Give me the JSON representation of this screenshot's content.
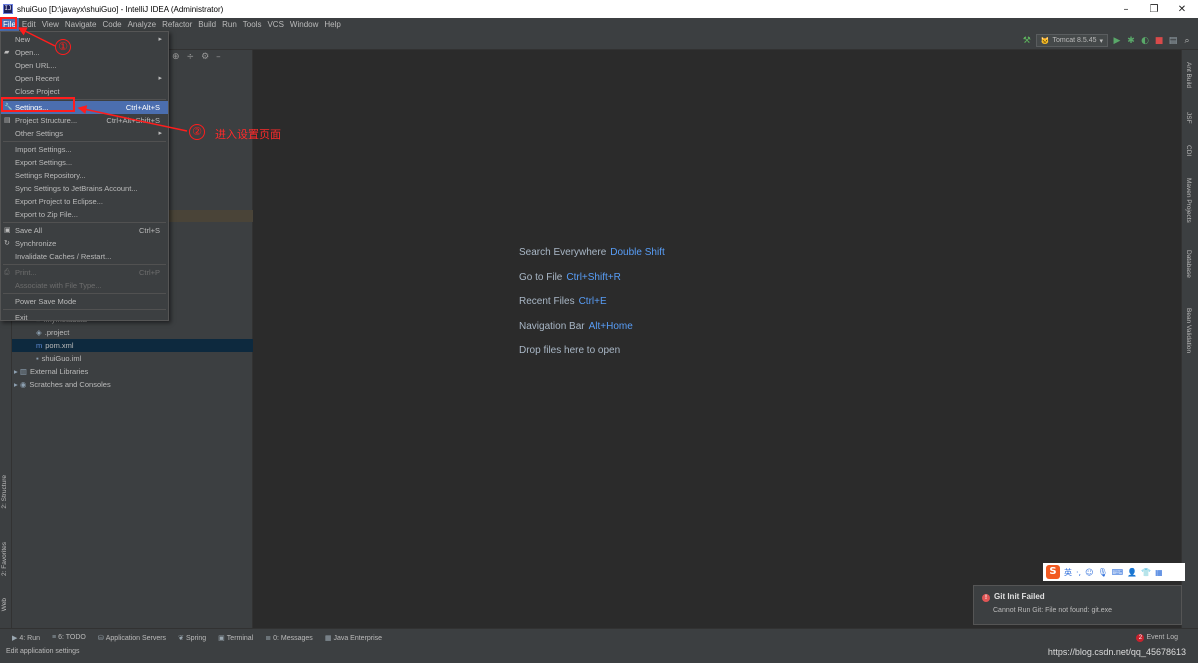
{
  "window": {
    "title": "shuiGuo [D:\\javayx\\shuiGuo] - IntelliJ IDEA (Administrator)",
    "minimize_glyph": "–",
    "maximize_glyph": "❐",
    "close_glyph": "✕"
  },
  "menubar": {
    "items": [
      "File",
      "Edit",
      "View",
      "Navigate",
      "Code",
      "Analyze",
      "Refactor",
      "Build",
      "Run",
      "Tools",
      "VCS",
      "Window",
      "Help"
    ],
    "active": "File"
  },
  "toolbar": {
    "run_config": "Tomcat 8.5.45"
  },
  "file_menu": {
    "items": [
      {
        "label": "New",
        "submenu": true
      },
      {
        "label": "Open...",
        "icon": "folder-icon"
      },
      {
        "label": "Open URL..."
      },
      {
        "label": "Open Recent",
        "submenu": true
      },
      {
        "label": "Close Project"
      },
      {
        "label": "Settings...",
        "shortcut": "Ctrl+Alt+S",
        "highlighted": true,
        "icon": "wrench-icon"
      },
      {
        "label": "Project Structure...",
        "shortcut": "Ctrl+Alt+Shift+S",
        "icon": "structure-icon"
      },
      {
        "label": "Other Settings",
        "submenu": true
      },
      {
        "label": "Import Settings..."
      },
      {
        "label": "Export Settings..."
      },
      {
        "label": "Settings Repository..."
      },
      {
        "label": "Sync Settings to JetBrains Account..."
      },
      {
        "label": "Export Project to Eclipse..."
      },
      {
        "label": "Export to Zip File..."
      },
      {
        "label": "Save All",
        "shortcut": "Ctrl+S",
        "icon": "save-icon"
      },
      {
        "label": "Synchronize",
        "icon": "sync-icon"
      },
      {
        "label": "Invalidate Caches / Restart..."
      },
      {
        "label": "Print...",
        "shortcut": "Ctrl+P",
        "disabled": true,
        "icon": "print-icon"
      },
      {
        "label": "Associate with File Type...",
        "disabled": true
      },
      {
        "label": "Power Save Mode"
      },
      {
        "label": "Exit"
      }
    ]
  },
  "project_tree": {
    "rows": [
      {
        "label": ".mymetadata",
        "indent": 24,
        "icon": "≡"
      },
      {
        "label": ".project",
        "indent": 24,
        "icon": "◈"
      },
      {
        "label": "pom.xml",
        "indent": 24,
        "icon": "m",
        "selected": true
      },
      {
        "label": "shuiGuo.iml",
        "indent": 24,
        "icon": "▪"
      },
      {
        "label": "External Libraries",
        "indent": 2,
        "icon": "▸ ▥"
      },
      {
        "label": "Scratches and Consoles",
        "indent": 2,
        "icon": "▸ ◉"
      }
    ]
  },
  "editor_hints": [
    {
      "text": "Search Everywhere",
      "key": "Double Shift"
    },
    {
      "text": "Go to File",
      "key": "Ctrl+Shift+R"
    },
    {
      "text": "Recent Files",
      "key": "Ctrl+E"
    },
    {
      "text": "Navigation Bar",
      "key": "Alt+Home"
    },
    {
      "text": "Drop files here to open",
      "key": ""
    }
  ],
  "left_tool_tabs": [
    "2: Structure",
    "2: Favorites",
    "Web"
  ],
  "right_tool_tabs": [
    "Ant Build",
    "JSF",
    "CDI",
    "Maven Projects",
    "Database",
    "Bean Validation"
  ],
  "bottom_tool_tabs": [
    "4: Run",
    "6: TODO",
    "Application Servers",
    "Spring",
    "Terminal",
    "0: Messages",
    "Java Enterprise"
  ],
  "event_log": {
    "count": "2",
    "label": "Event Log"
  },
  "status_text": "Edit application settings",
  "watermark": "https://blog.csdn.net/qq_45678613",
  "notification": {
    "title": "Git Init Failed",
    "body": "Cannot Run Git: File not found: git.exe"
  },
  "ime": {
    "lang": "英"
  },
  "annotations": {
    "step1": "①",
    "step2": "②",
    "step2_text": "进入设置页面"
  },
  "colors": {
    "accent": "#4b6eaf",
    "annotation_red": "#ff1d1d",
    "link_key": "#589df6"
  }
}
